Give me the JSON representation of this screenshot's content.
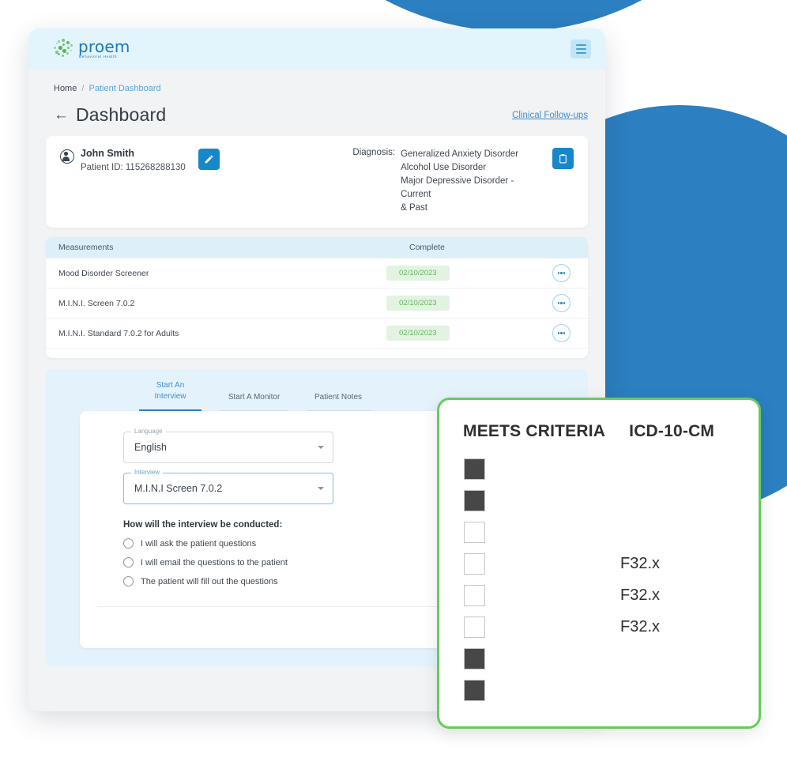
{
  "brand": {
    "logo_word": "proem",
    "logo_sub": "Behavioral Health",
    "logo_dot_color": "#53b848",
    "logo_text_color": "#1b76bc"
  },
  "header": {
    "menu_icon": "hamburger-icon",
    "background": "#e2f4fc"
  },
  "breadcrumb": {
    "home": "Home",
    "separator": "/",
    "current": "Patient Dashboard"
  },
  "page": {
    "back_arrow": "←",
    "title": "Dashboard",
    "followups_link": "Clinical Follow-ups"
  },
  "patient": {
    "name": "John Smith",
    "id_label": "Patient ID: 115268288130",
    "edit_icon": "pencil-icon",
    "clipboard_icon": "clipboard-icon",
    "diagnosis_label": "Diagnosis:",
    "diagnoses": [
      "Generalized Anxiety Disorder",
      "Alcohol Use Disorder",
      "Major Depressive Disorder - Current",
      "& Past"
    ]
  },
  "measurements": {
    "columns": [
      "Measurements",
      "Complete"
    ],
    "rows": [
      {
        "name": "Mood Disorder Screener",
        "complete": "02/10/2023",
        "action_icon": "more-options-icon"
      },
      {
        "name": "M.I.N.I. Screen 7.0.2",
        "complete": "02/10/2023",
        "action_icon": "more-options-icon"
      },
      {
        "name": "M.I.N.I. Standard 7.0.2 for Adults",
        "complete": "02/10/2023",
        "action_icon": "more-options-icon"
      }
    ],
    "badge_bg": "#e2f3e1",
    "badge_text_color": "#63b75e"
  },
  "interview": {
    "tabs": [
      {
        "label": "Start An Interview",
        "line1": "Start An",
        "line2": "Interview",
        "active": true
      },
      {
        "label": "Start A Monitor",
        "active": false
      },
      {
        "label": "Patient Notes",
        "active": false
      }
    ],
    "language_field": {
      "label": "Language",
      "value": "English"
    },
    "interview_field": {
      "label": "Interview",
      "value": "M.I.N.I Screen 7.0.2"
    },
    "question_label": "How will the interview be conducted:",
    "options": [
      "I will ask the patient questions",
      "I will email the questions to the patient",
      "The patient will fill out the questions"
    ],
    "submit_label": "",
    "accent_color": "#2f86c4",
    "panel_bg": "#e4f3fb"
  },
  "criteria_panel": {
    "border_color": "#66cc5a",
    "headers": {
      "meets": "MEETS CRITERIA",
      "icd": "ICD-10-CM"
    },
    "rows": [
      {
        "checked": true,
        "icd": ""
      },
      {
        "checked": true,
        "icd": ""
      },
      {
        "checked": false,
        "icd": ""
      },
      {
        "checked": false,
        "icd": "F32.x"
      },
      {
        "checked": false,
        "icd": "F32.x"
      },
      {
        "checked": false,
        "icd": "F32.x"
      },
      {
        "checked": true,
        "icd": ""
      },
      {
        "checked": true,
        "icd": ""
      }
    ]
  },
  "decoration": {
    "circle_color": "#2c7fc0"
  }
}
